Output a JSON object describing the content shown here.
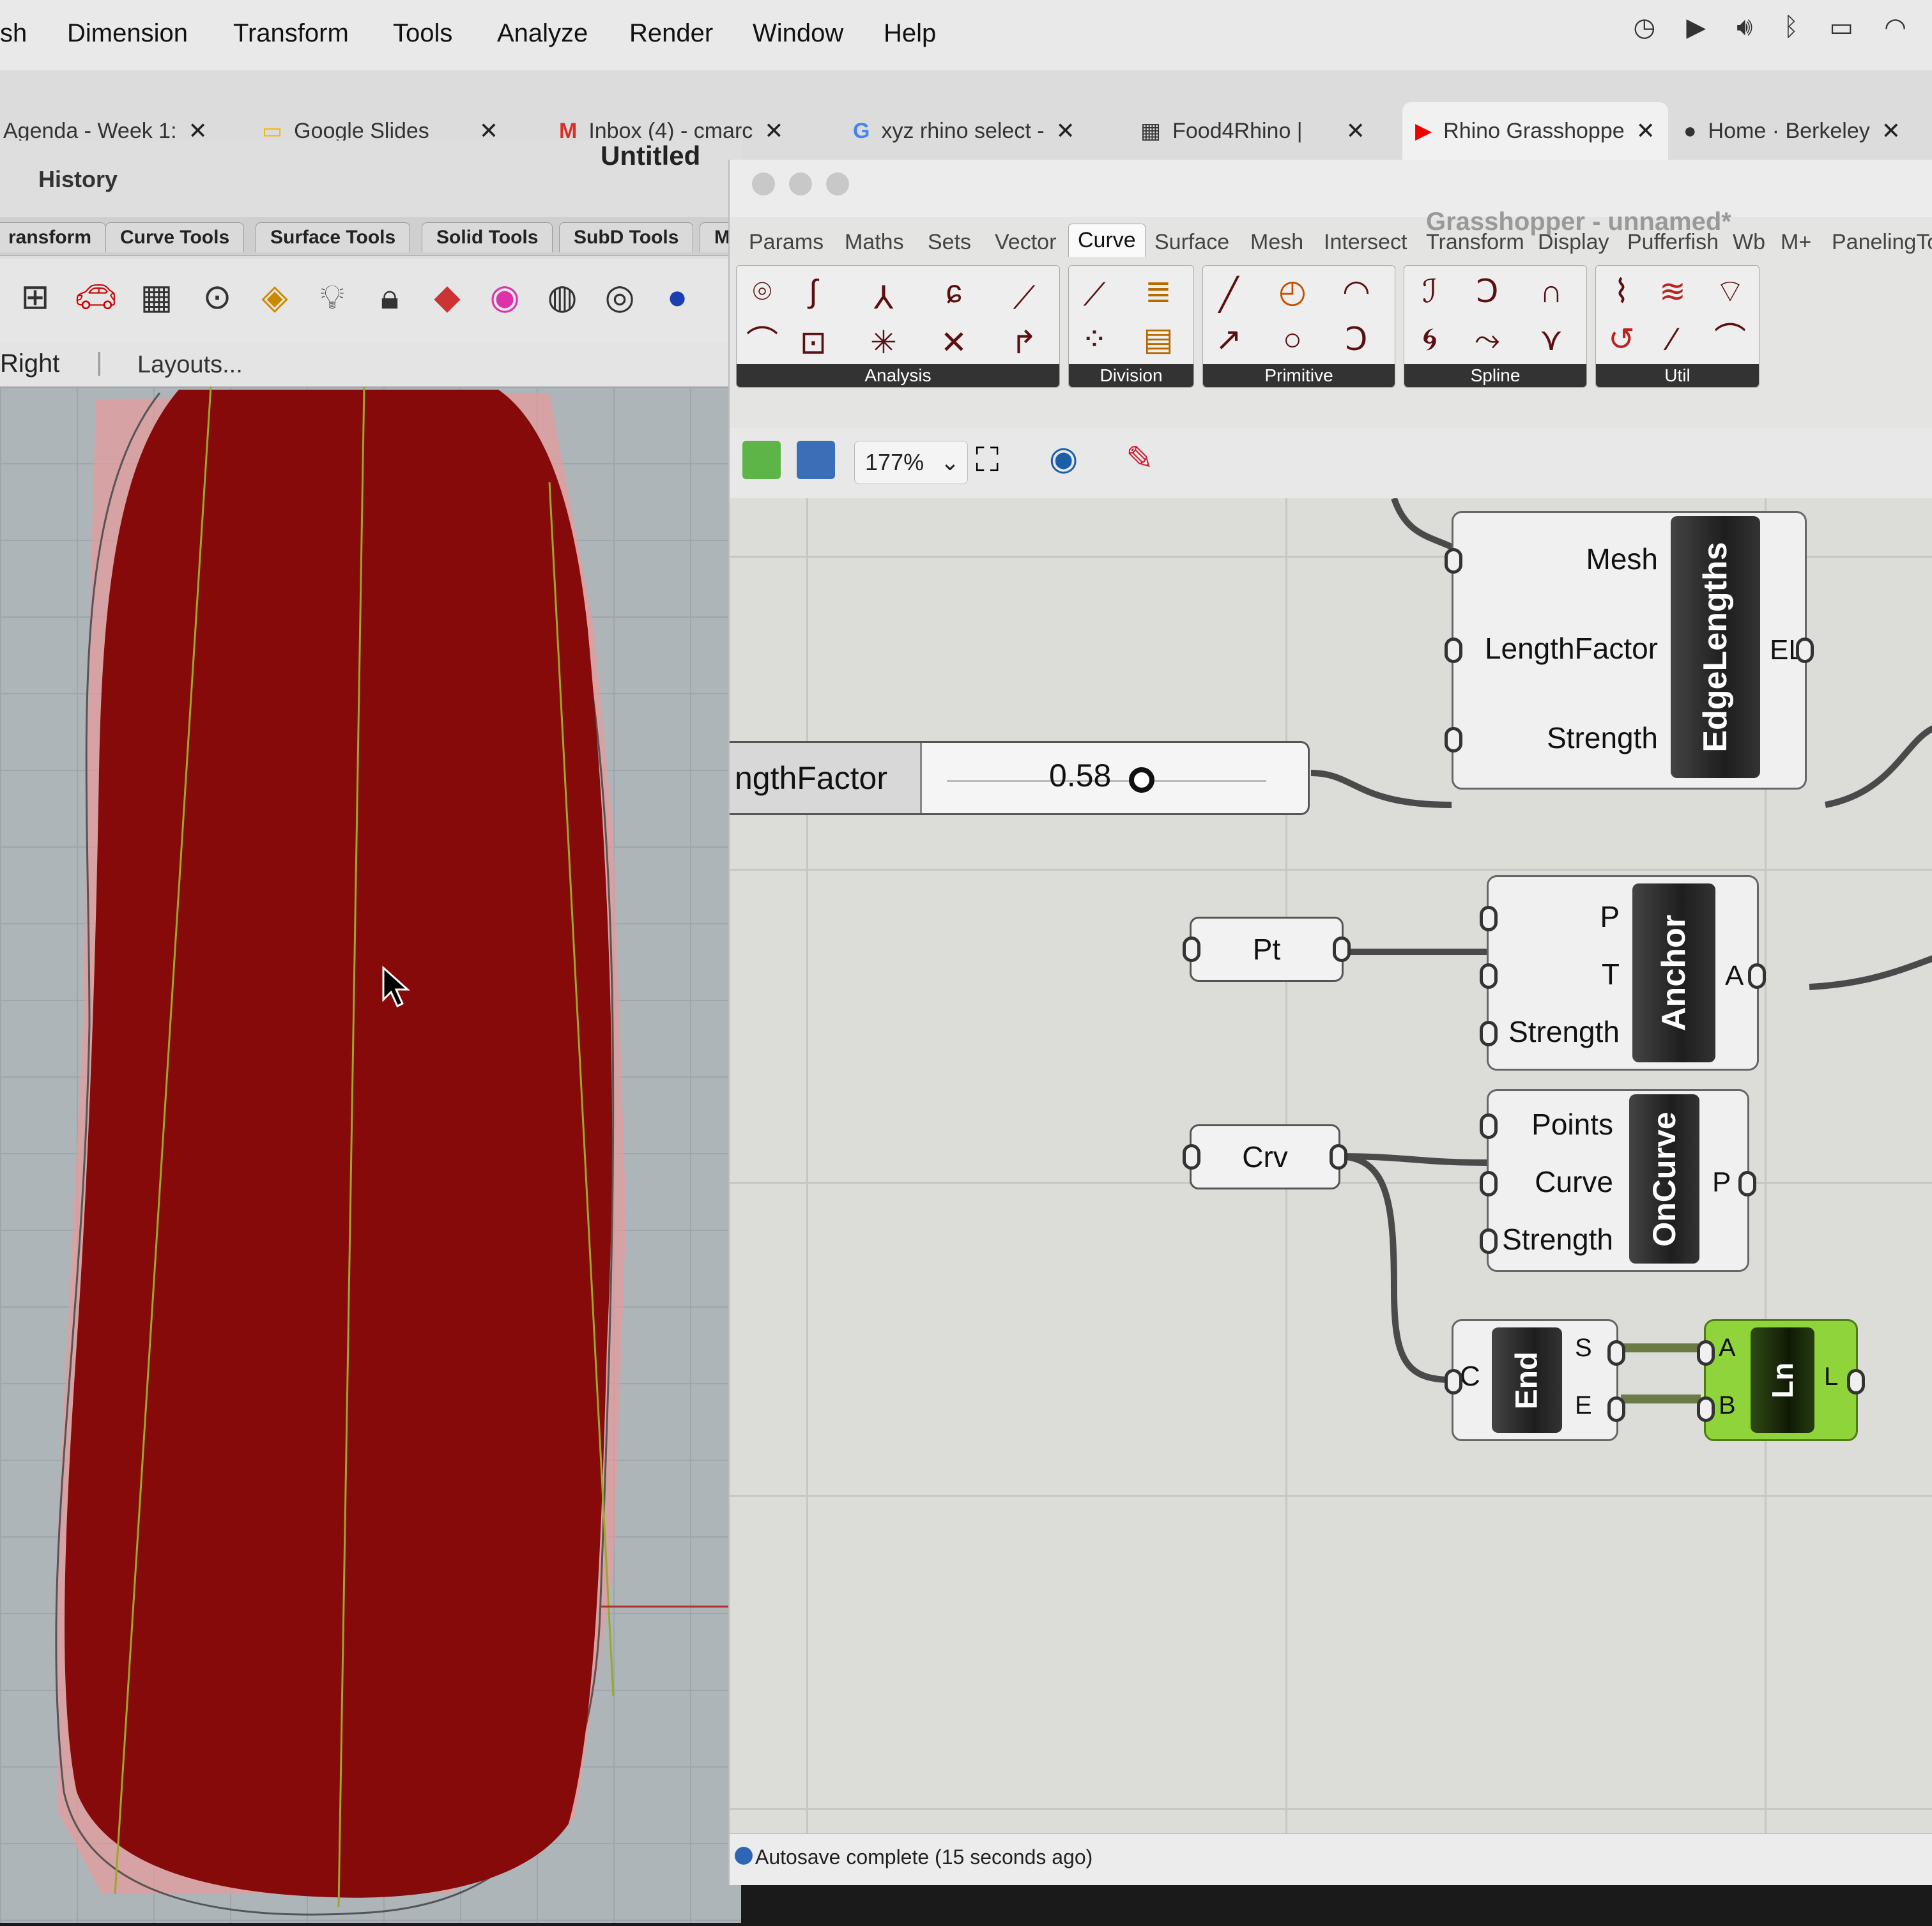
{
  "menubar": {
    "items": [
      "sh",
      "Dimension",
      "Transform",
      "Tools",
      "Analyze",
      "Render",
      "Window",
      "Help"
    ]
  },
  "browser_tabs": [
    {
      "label": "Agenda - Week 1:"
    },
    {
      "label": "Google Slides"
    },
    {
      "label": "Inbox (4) - cmarc"
    },
    {
      "label": "xyz rhino select -"
    },
    {
      "label": "Food4Rhino |"
    },
    {
      "label": "Rhino Grasshoppe"
    },
    {
      "label": "Home · Berkeley"
    }
  ],
  "rhino": {
    "title": "Untitled",
    "history_label": "History",
    "tool_tabs": [
      "ransform",
      "Curve Tools",
      "Surface Tools",
      "Solid Tools",
      "SubD Tools",
      "Me"
    ],
    "viewport_label": "Right",
    "layouts_label": "Layouts..."
  },
  "grasshopper": {
    "window_title": "Grasshopper - unnamed*",
    "tabs": [
      "Params",
      "Maths",
      "Sets",
      "Vector",
      "Curve",
      "Surface",
      "Mesh",
      "Intersect",
      "Transform",
      "Display",
      "Pufferfish",
      "Wb",
      "M+",
      "PanelingTo"
    ],
    "selected_tab": "Curve",
    "groups": [
      "Analysis",
      "Division",
      "Primitive",
      "Spline",
      "Util"
    ],
    "zoom": "177%",
    "slider": {
      "label": "ngthFactor",
      "value": "0.58"
    },
    "components": {
      "edge_lengths": {
        "name": "EdgeLengths",
        "inputs": [
          "Mesh",
          "LengthFactor",
          "Strength"
        ],
        "output": "EL"
      },
      "anchor": {
        "name": "Anchor",
        "inputs": [
          "P",
          "T",
          "Strength"
        ],
        "output": "A"
      },
      "on_curve": {
        "name": "OnCurve",
        "inputs": [
          "Points",
          "Curve",
          "Strength"
        ],
        "output": "P"
      },
      "end": {
        "name": "End",
        "input": "C",
        "outputs": [
          "S",
          "E"
        ]
      },
      "line": {
        "name": "Ln",
        "inputs": [
          "A",
          "B"
        ],
        "output": "L"
      }
    },
    "params": {
      "pt": "Pt",
      "crv": "Crv"
    },
    "status": "Autosave complete (15 seconds ago)"
  },
  "colors": {
    "shape_fill": "#860a0a",
    "shape_halo": "#e89a9a",
    "line_component": "#8fd43a"
  }
}
